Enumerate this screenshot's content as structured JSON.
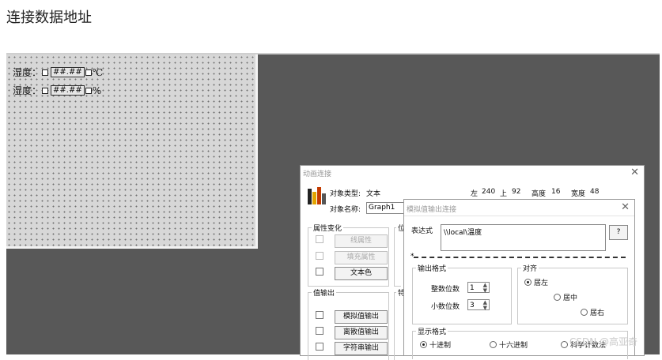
{
  "page": {
    "heading": "连接数据地址"
  },
  "design_panel": {
    "rows": [
      {
        "label": "湿度：",
        "value": "##.##",
        "unit": "℃"
      },
      {
        "label": "湿度：",
        "value": "##.##",
        "unit": "%"
      }
    ]
  },
  "dynamic_dialog": {
    "title": "动画连接",
    "object_type_label": "对象类型:",
    "object_type": "文本",
    "object_name_label": "对象名称:",
    "object_name": "Graph1",
    "pos": {
      "left_label": "左",
      "left": "240",
      "top_label": "上",
      "top": "92",
      "height_label": "高度",
      "height": "16",
      "width_label": "宽度",
      "width": "48"
    },
    "attr_group": "属性变化",
    "attr_buttons": [
      "线属性",
      "填充属性",
      "文本色"
    ],
    "value_group": "值输出",
    "value_buttons": [
      "模拟值输出",
      "离散值输出",
      "字符串输出"
    ]
  },
  "analog_dialog": {
    "title": "模拟值输出连接",
    "expr_label": "表达式",
    "expr_value": "\\\\local\\温度",
    "q_button": "?",
    "star": "*",
    "output_format": "输出格式",
    "int_label": "整数位数",
    "int_value": "1",
    "dec_label": "小数位数",
    "dec_value": "3",
    "align_group": "对齐",
    "align_options": [
      "居左",
      "居中",
      "居右"
    ],
    "display_format": "显示格式",
    "display_options": [
      "十进制",
      "十六进制",
      "科学计数法"
    ]
  },
  "watermark": "CSDN @高亚奇"
}
